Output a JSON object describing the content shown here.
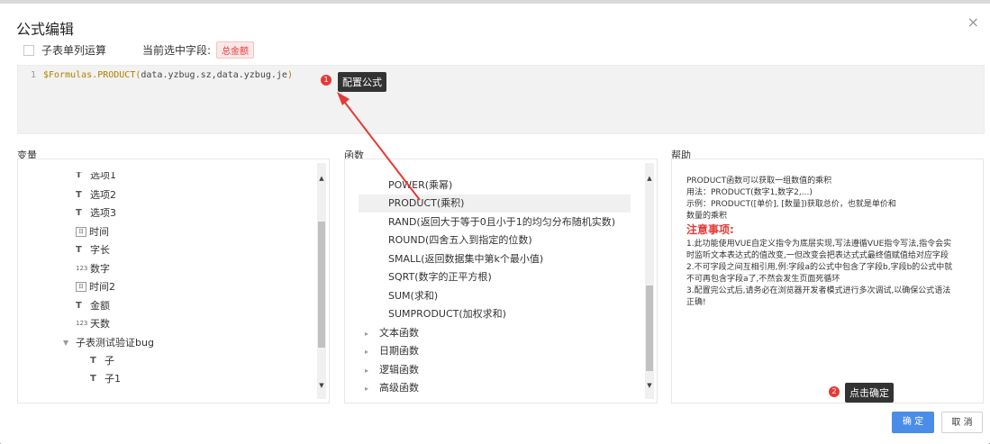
{
  "dialog": {
    "title": "公式编辑",
    "close_glyph": "×",
    "subtable_checkbox_label": "子表单列运算",
    "current_field_label": "当前选中字段:",
    "current_field_value": "总金额"
  },
  "editor": {
    "line_number": "1",
    "code_prefix": "$Formulas.PRODUCT(",
    "code_args": "data.yzbug.sz,data.yzbug.je",
    "code_suffix": ")"
  },
  "sections": {
    "variables": "变量",
    "functions": "函数",
    "help": "帮助"
  },
  "variables": [
    {
      "icon": "T",
      "label": "选项1",
      "icon_name": "text-type-icon"
    },
    {
      "icon": "T",
      "label": "选项2",
      "icon_name": "text-type-icon"
    },
    {
      "icon": "T",
      "label": "选项3",
      "icon_name": "text-type-icon"
    },
    {
      "icon": "日",
      "label": "时间",
      "icon_name": "calendar-icon"
    },
    {
      "icon": "T",
      "label": "字长",
      "icon_name": "text-type-icon"
    },
    {
      "icon": "123",
      "label": "数字",
      "icon_name": "number-type-icon"
    },
    {
      "icon": "日",
      "label": "时间2",
      "icon_name": "calendar-icon"
    },
    {
      "icon": "T",
      "label": "金额",
      "icon_name": "text-type-icon"
    },
    {
      "icon": "123",
      "label": "天数",
      "icon_name": "number-type-icon"
    },
    {
      "icon": "▼",
      "label": "子表测试验证bug",
      "icon_name": "expand-arrow-icon"
    },
    {
      "icon": "T",
      "label": "子",
      "icon_name": "text-type-icon"
    },
    {
      "icon": "T",
      "label": "子1",
      "icon_name": "text-type-icon"
    }
  ],
  "functions": [
    "POWER(乘幂)",
    "PRODUCT(乘积)",
    "RAND(返回大于等于0且小于1的均匀分布随机实数)",
    "ROUND(四舍五入到指定的位数)",
    "SMALL(返回数据集中第k个最小值)",
    "SQRT(数字的正平方根)",
    "SUM(求和)",
    "SUMPRODUCT(加权求和)"
  ],
  "function_categories": [
    "文本函数",
    "日期函数",
    "逻辑函数",
    "高级函数"
  ],
  "help": {
    "line1": "PRODUCT函数可以获取一组数值的乘积",
    "line2": "用法：PRODUCT(数字1,数字2,...)",
    "line3": "示例：PRODUCT([单价], [数量])获取总价，也就是单价和",
    "line4": "数量的乘积",
    "note_title": "注意事项:",
    "note1a": "1.此功能使用VUE自定义指令为底层实现,写法遵循VUE指令写法,指令会实",
    "note1b": "时监听文本表达式的值改变,一但改变会把表达式式最终值赋值给对应字段",
    "note2a": "2.不可字段之间互相引用,例:字段a的公式中包含了字段b,字段b的公式中就",
    "note2b": "不可再包含字段a了,不然会发生页面死循环",
    "note3a": "3.配置完公式后,请务必在浏览器开发者模式进行多次调试,以确保公式语法",
    "note3b": "正确!"
  },
  "annotations": {
    "marker1": "1",
    "tooltip1": "配置公式",
    "marker2": "2",
    "tooltip2": "点击确定",
    "arrow_color": "#e53935"
  },
  "buttons": {
    "ok": "确 定",
    "cancel": "取 消"
  },
  "colors": {
    "primary": "#4a8de9",
    "danger": "#e53935"
  }
}
